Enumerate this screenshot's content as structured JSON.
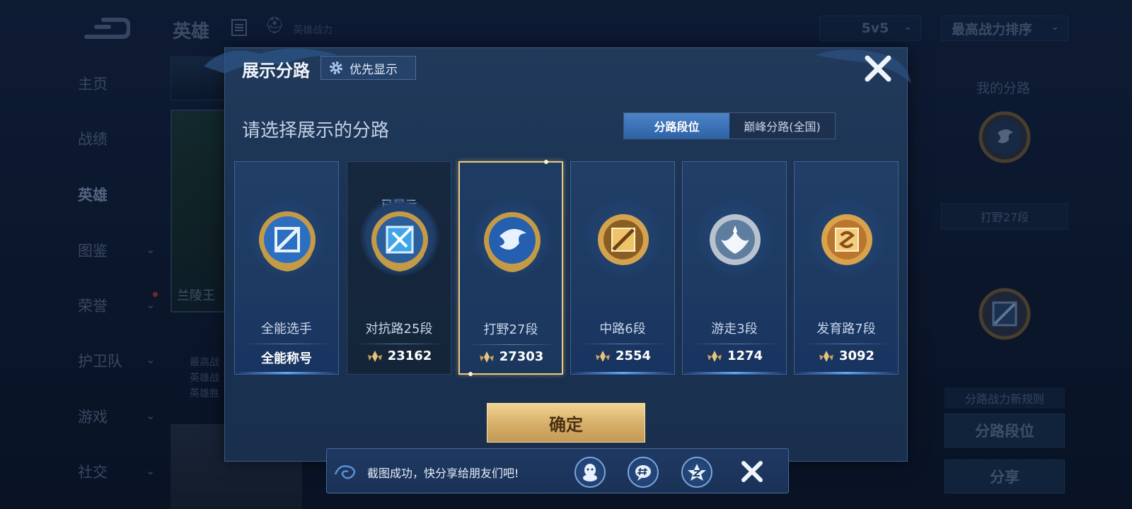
{
  "sidebar": {
    "items": [
      {
        "label": "主页",
        "has_chevron": false
      },
      {
        "label": "战绩",
        "has_chevron": false
      },
      {
        "label": "英雄",
        "has_chevron": false,
        "active": true
      },
      {
        "label": "图鉴",
        "has_chevron": true
      },
      {
        "label": "荣誉",
        "has_chevron": true
      },
      {
        "label": "护卫队",
        "has_chevron": true
      },
      {
        "label": "游戏",
        "has_chevron": true
      },
      {
        "label": "社交",
        "has_chevron": true
      }
    ],
    "chevron_glyph": "⌄"
  },
  "header": {
    "title": "英雄",
    "subtitle": "英雄战力",
    "mode_dropdown": "5v5",
    "sort_dropdown": "最高战力排序"
  },
  "hero_card": {
    "name": "兰陵王",
    "info_lines": [
      "最高战",
      "英雄战",
      "英雄胜"
    ]
  },
  "right_panel": {
    "title": "我的分路",
    "lane_label": "打野27段",
    "rules_label": "分路战力新规则",
    "lane_rank_button": "分路段位",
    "share_button": "分享"
  },
  "modal": {
    "title": "展示分路",
    "priority_button": "优先显示",
    "subtitle": "请选择展示的分路",
    "tabs": [
      {
        "label": "分路段位",
        "active": true
      },
      {
        "label": "巅峰分路(全国)",
        "active": false
      }
    ],
    "lanes": [
      {
        "name": "全能选手",
        "power": "全能称号",
        "shown_label": "",
        "icon": "all-round-emblem-icon",
        "selected": false,
        "dimmed": false
      },
      {
        "name": "对抗路25段",
        "power": "23162",
        "shown_label": "已展示",
        "icon": "clash-lane-emblem-icon",
        "selected": false,
        "dimmed": true
      },
      {
        "name": "打野27段",
        "power": "27303",
        "shown_label": "",
        "icon": "jungle-emblem-icon",
        "selected": true,
        "dimmed": false
      },
      {
        "name": "中路6段",
        "power": "2554",
        "shown_label": "",
        "icon": "mid-lane-emblem-icon",
        "selected": false,
        "dimmed": false
      },
      {
        "name": "游走3段",
        "power": "1274",
        "shown_label": "",
        "icon": "roam-emblem-icon",
        "selected": false,
        "dimmed": false
      },
      {
        "name": "发育路7段",
        "power": "3092",
        "shown_label": "",
        "icon": "farm-lane-emblem-icon",
        "selected": false,
        "dimmed": false
      }
    ],
    "confirm_label": "确定",
    "colors": {
      "gold": "#e8c882",
      "accent_blue": "#3f74bb",
      "modal_bg": "#1d3455"
    }
  },
  "toast": {
    "text": "截图成功，快分享给朋友们吧!",
    "share_targets": [
      "qq-icon",
      "wechat-icon",
      "qzone-icon"
    ]
  }
}
